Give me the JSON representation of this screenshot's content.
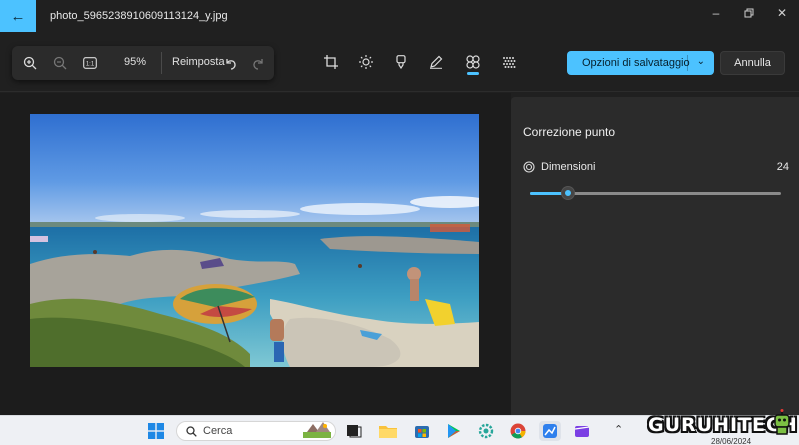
{
  "titlebar": {
    "filename": "photo_5965238910609113124_y.jpg"
  },
  "toolbar": {
    "zoom_percent": "95%",
    "reset_label": "Reimposta",
    "save_label": "Opzioni di salvataggio",
    "cancel_label": "Annulla",
    "active_tool": "spot-fix"
  },
  "panel": {
    "title": "Correzione punto",
    "size_label": "Dimensioni",
    "size_value": "24",
    "size_fraction": 0.15
  },
  "taskbar": {
    "search_label": "Cerca"
  },
  "watermark": {
    "text": "GURUHITECH",
    "date": "28/06/2024"
  },
  "colors": {
    "accent": "#4cc2ff",
    "window_bg": "#202020",
    "panel_bg": "#2b2b2b",
    "taskbar_bg": "#eef0f4"
  }
}
